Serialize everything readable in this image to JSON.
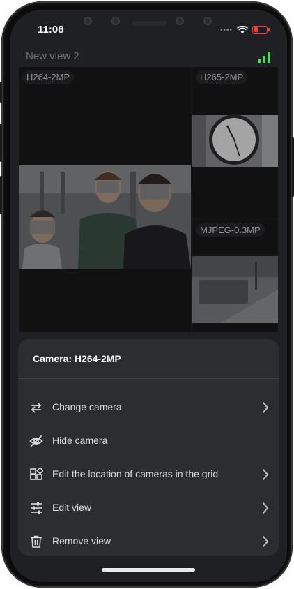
{
  "status_bar": {
    "time": "11:08"
  },
  "view": {
    "title": "New view 2"
  },
  "tiles": [
    {
      "label": "H264-2MP"
    },
    {
      "label": "H265-2MP"
    },
    {
      "label": "MJPEG-0.3MP"
    }
  ],
  "sheet": {
    "title": "Camera: H264-2MP",
    "items": [
      {
        "label": "Change camera",
        "icon": "swap-arrows-icon",
        "has_chevron": true
      },
      {
        "label": "Hide camera",
        "icon": "eye-off-icon",
        "has_chevron": false
      },
      {
        "label": "Edit the location of cameras in the grid",
        "icon": "grid-edit-icon",
        "has_chevron": true
      },
      {
        "label": "Edit view",
        "icon": "sliders-icon",
        "has_chevron": true
      },
      {
        "label": "Remove view",
        "icon": "trash-icon",
        "has_chevron": true
      }
    ]
  },
  "colors": {
    "background": "#1f2023",
    "sheet": "#2c2d30",
    "signal": "#4cd964",
    "battery_low": "#ff3b30"
  }
}
